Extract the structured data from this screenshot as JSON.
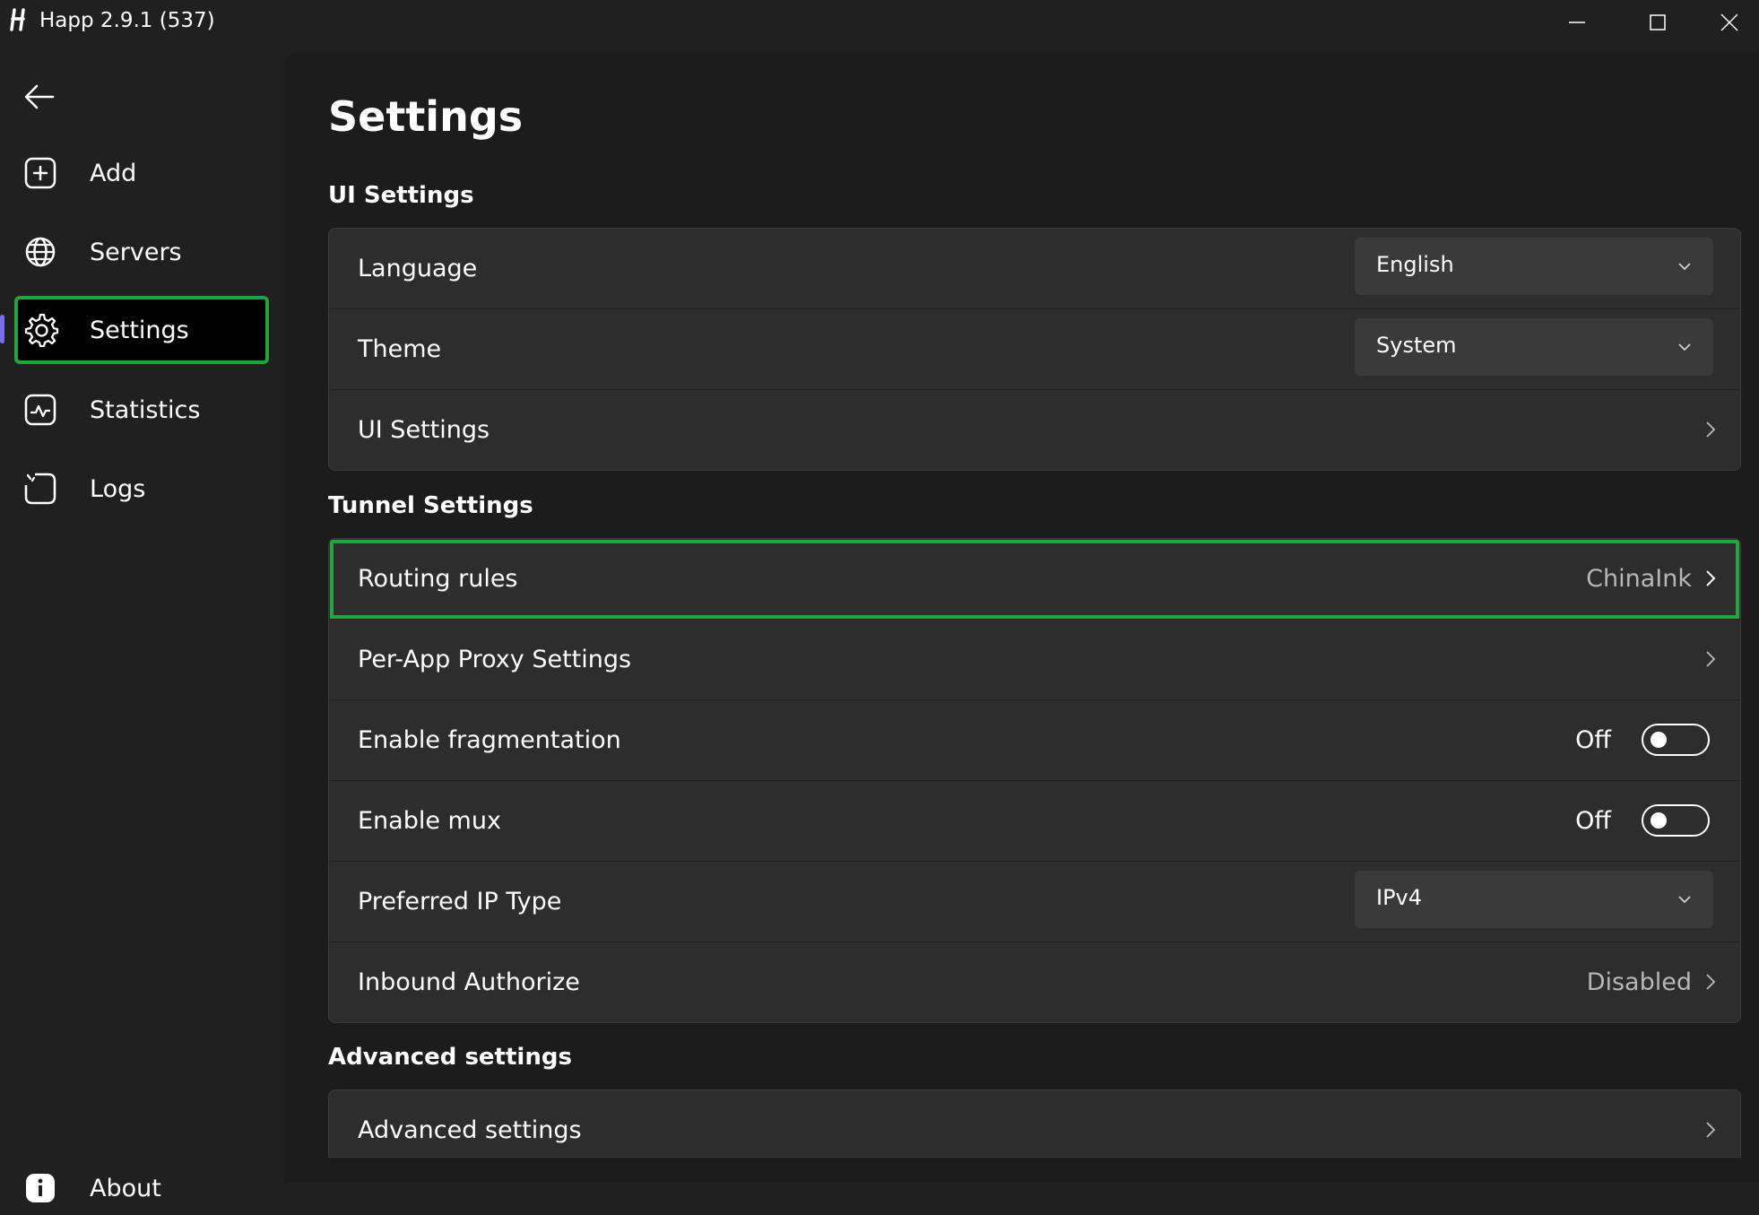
{
  "window": {
    "title": "Happ 2.9.1 (537)",
    "logo_letter": "H"
  },
  "sidebar": {
    "items": [
      {
        "label": "Add",
        "icon": "add-box-icon"
      },
      {
        "label": "Servers",
        "icon": "globe-icon"
      },
      {
        "label": "Settings",
        "icon": "gear-icon",
        "active": true
      },
      {
        "label": "Statistics",
        "icon": "chart-icon"
      },
      {
        "label": "Logs",
        "icon": "logs-icon"
      }
    ],
    "about_label": "About"
  },
  "main": {
    "title": "Settings",
    "sections": [
      {
        "title": "UI Settings",
        "rows": [
          {
            "label": "Language",
            "control": "dropdown",
            "value": "English"
          },
          {
            "label": "Theme",
            "control": "dropdown",
            "value": "System"
          },
          {
            "label": "UI Settings",
            "control": "link"
          }
        ]
      },
      {
        "title": "Tunnel Settings",
        "rows": [
          {
            "label": "Routing rules",
            "control": "link",
            "value": "ChinaInk"
          },
          {
            "label": "Per-App Proxy Settings",
            "control": "link"
          },
          {
            "label": "Enable fragmentation",
            "control": "toggle",
            "value": "Off"
          },
          {
            "label": "Enable mux",
            "control": "toggle",
            "value": "Off"
          },
          {
            "label": "Preferred IP Type",
            "control": "dropdown",
            "value": "IPv4"
          },
          {
            "label": "Inbound Authorize",
            "control": "link",
            "value": "Disabled"
          }
        ]
      },
      {
        "title": "Advanced settings",
        "rows": [
          {
            "label": "Advanced settings",
            "control": "link"
          }
        ]
      }
    ]
  },
  "colors": {
    "background": "#202020",
    "card": "#2d2d2d",
    "highlight": "#1fa83a",
    "accent": "#7b6cf0"
  }
}
